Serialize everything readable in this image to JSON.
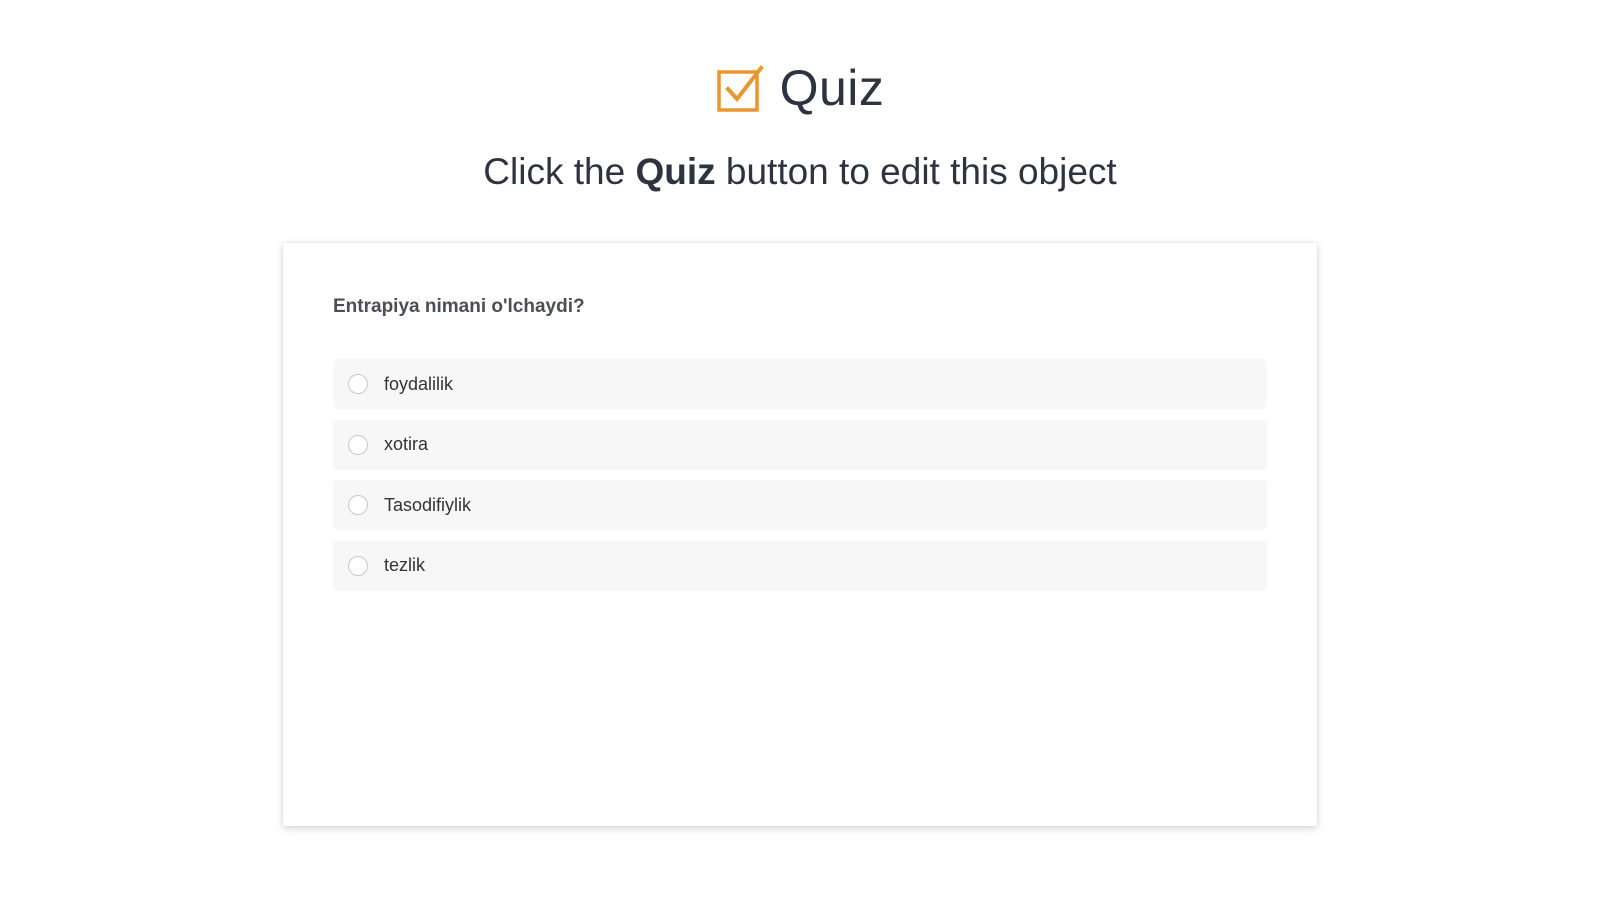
{
  "header": {
    "title": "Quiz",
    "icon": "checkbox-check-icon",
    "icon_color": "#e8962e"
  },
  "subtitle": {
    "prefix": "Click the ",
    "emphasis": "Quiz",
    "suffix": " button to edit this object"
  },
  "quiz": {
    "question": "Entrapiya nimani o'lchaydi?",
    "options": [
      {
        "label": "foydalilik",
        "selected": false
      },
      {
        "label": "xotira",
        "selected": false
      },
      {
        "label": "Tasodifiylik",
        "selected": false
      },
      {
        "label": "tezlik",
        "selected": false
      }
    ]
  }
}
